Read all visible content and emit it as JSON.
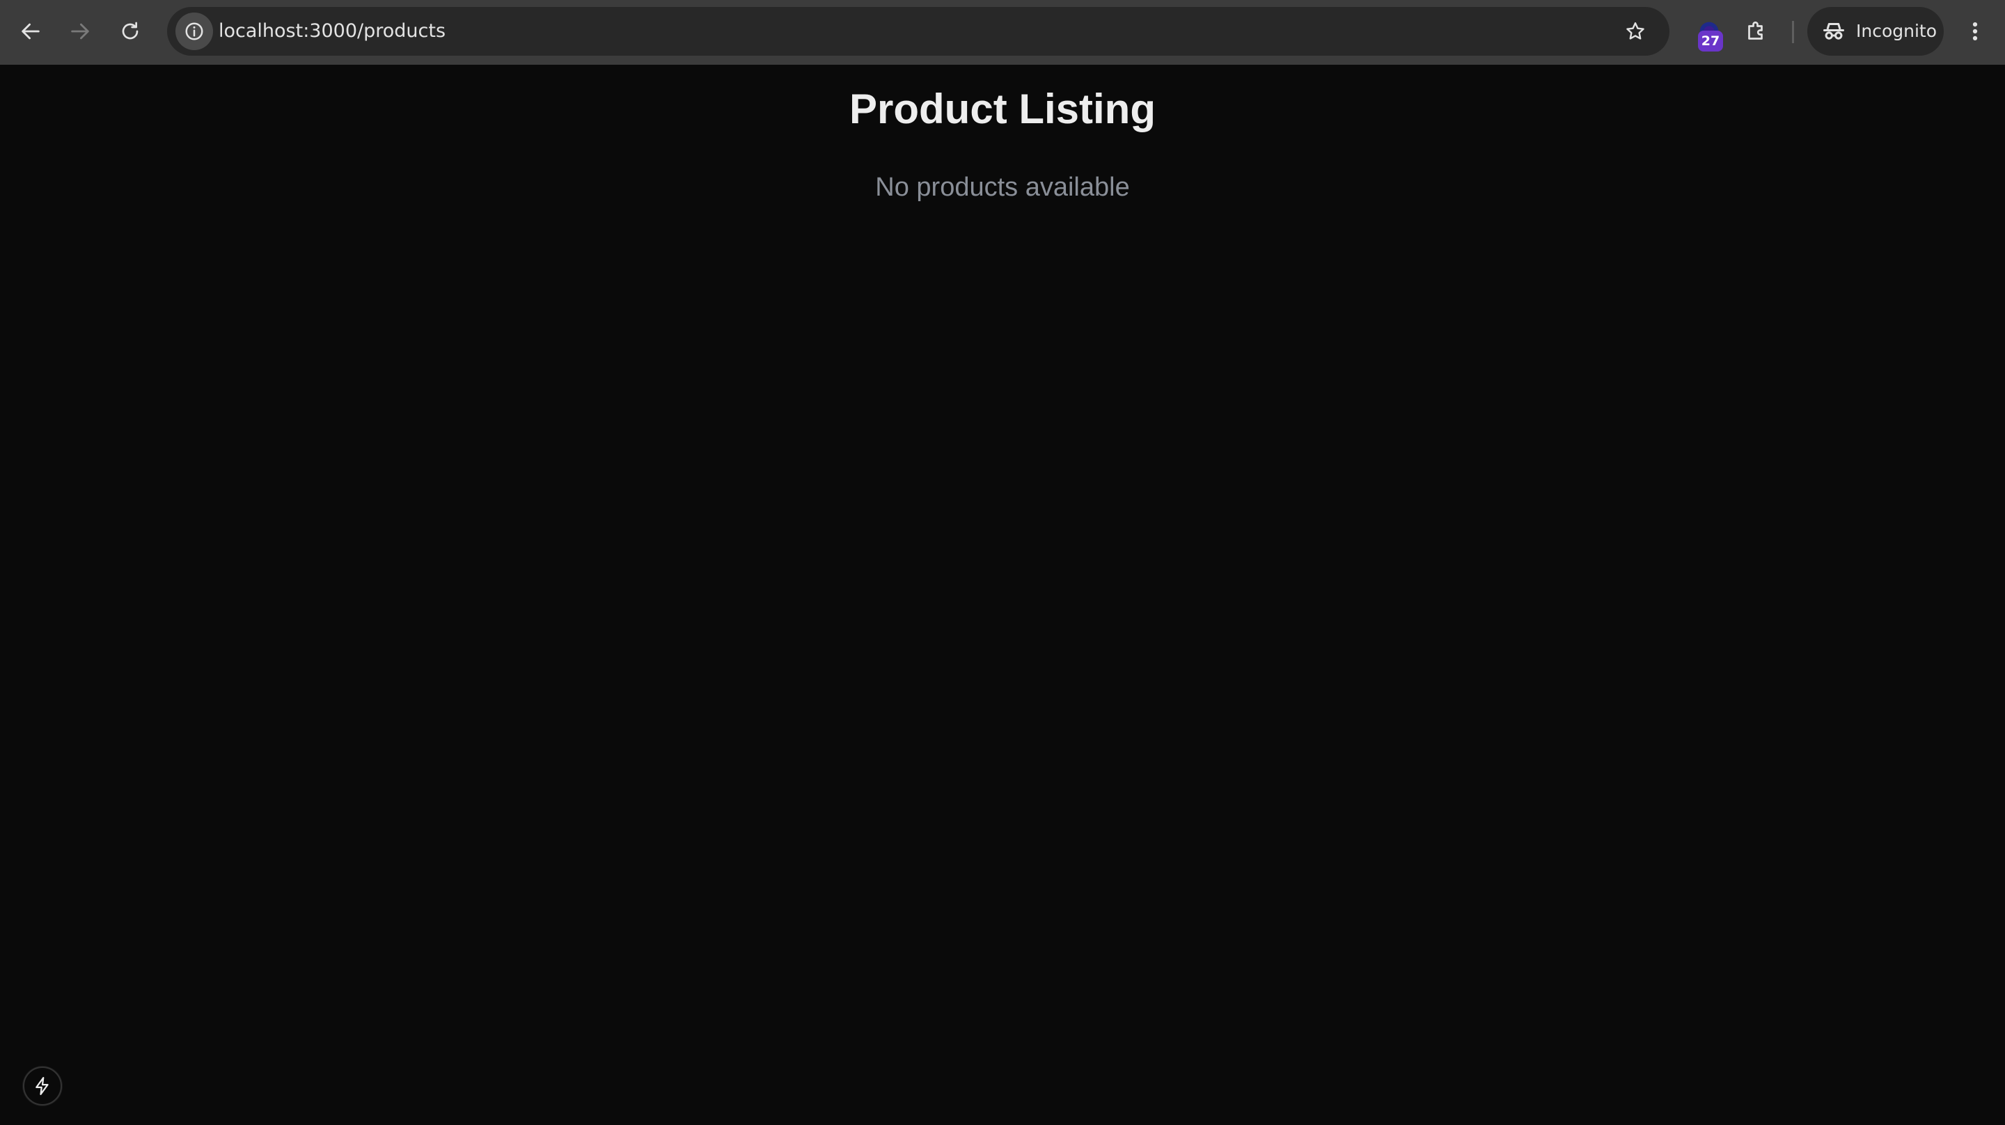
{
  "browser": {
    "url": "localhost:3000/products",
    "extension_badge": "27",
    "profile_label": "Incognito",
    "icons": {
      "back": "back-arrow-icon",
      "forward": "forward-arrow-icon",
      "reload": "reload-icon",
      "site_info": "info-icon",
      "bookmark": "star-icon",
      "extensions": "puzzle-icon",
      "incognito": "incognito-icon",
      "menu": "kebab-menu-icon"
    },
    "colors": {
      "toolbar": "#3c3c3c",
      "omnibox": "#282828",
      "badge": "#6a35c9"
    }
  },
  "page": {
    "title": "Product Listing",
    "empty_message": "No products available",
    "colors": {
      "background": "#0a0a0a",
      "title": "#ededed",
      "muted_text": "#8a8f98"
    }
  },
  "dev_tools": {
    "indicator_icon": "lightning-bolt-icon"
  }
}
